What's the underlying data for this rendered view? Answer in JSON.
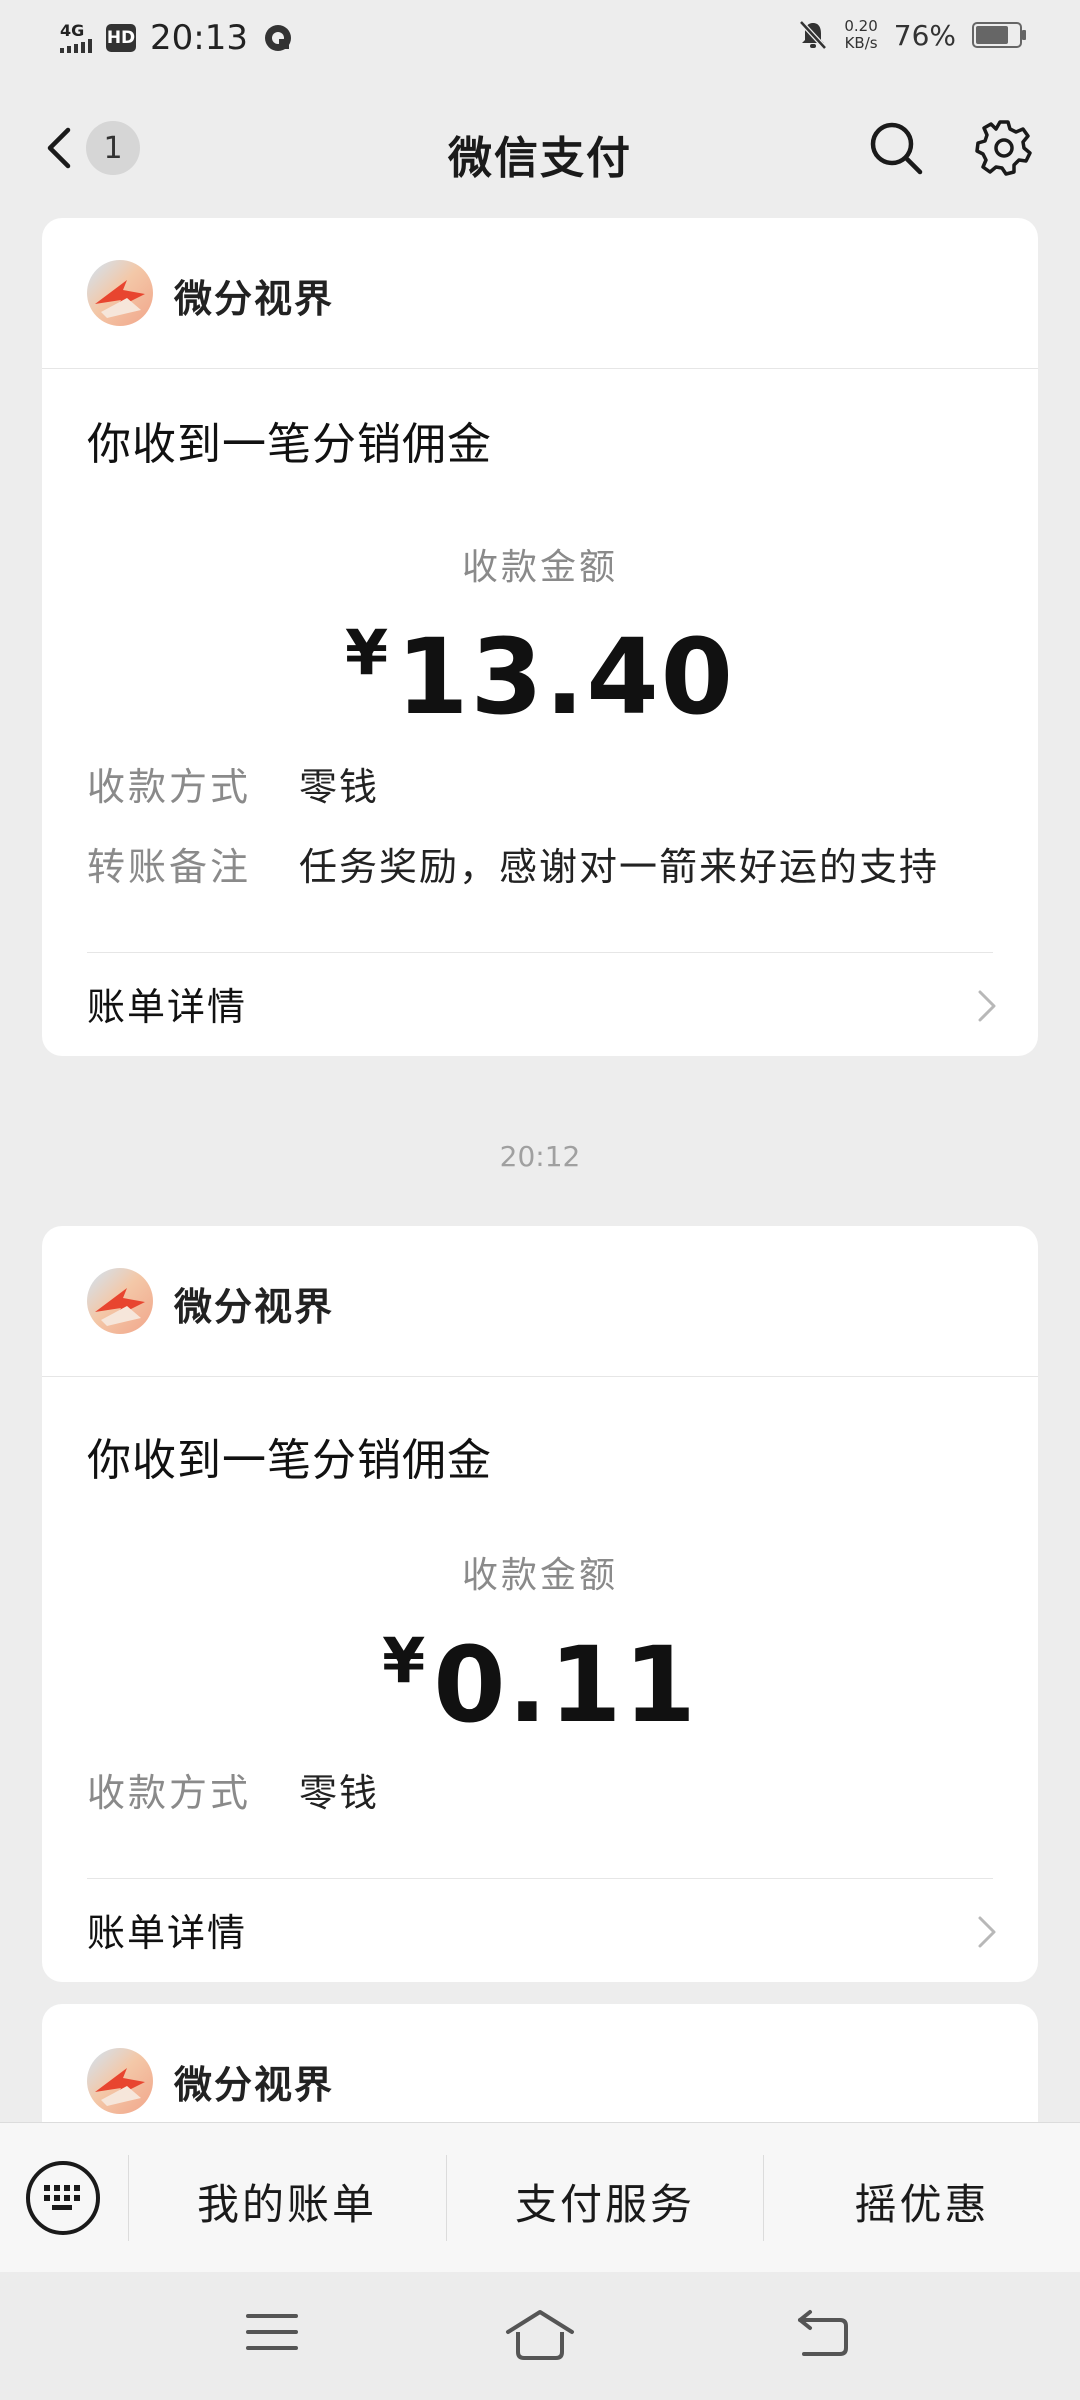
{
  "status_bar": {
    "network": "4G",
    "hd": "HD",
    "time": "20:13",
    "speed_value": "0.20",
    "speed_unit": "KB/s",
    "battery": "76%"
  },
  "nav": {
    "unread_count": "1",
    "title": "微信支付"
  },
  "cards": [
    {
      "merchant": "微分视界",
      "title": "你收到一笔分销佣金",
      "amount_label": "收款金额",
      "currency": "¥",
      "amount": "13.40",
      "method_label": "收款方式",
      "method_value": "零钱",
      "note_label": "转账备注",
      "note_value": "任务奖励，感谢对一箭来好运的支持",
      "detail_label": "账单详情"
    },
    {
      "merchant": "微分视界",
      "title": "你收到一笔分销佣金",
      "amount_label": "收款金额",
      "currency": "¥",
      "amount": "0.11",
      "method_label": "收款方式",
      "method_value": "零钱",
      "detail_label": "账单详情"
    },
    {
      "merchant": "微分视界"
    }
  ],
  "timestamp": "20:12",
  "bottom_menu": {
    "items": [
      "我的账单",
      "支付服务",
      "摇优惠"
    ]
  }
}
